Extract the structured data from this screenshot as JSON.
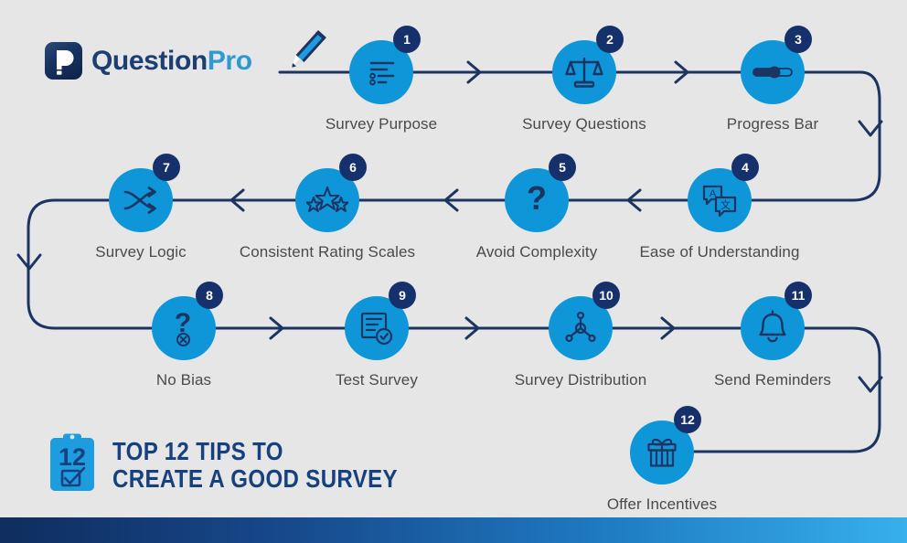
{
  "brand": {
    "logo_icon": "questionpro-p-question-logo",
    "name_part1": "Question",
    "name_part2": "Pro",
    "navy": "#17407e",
    "blue": "#0f96d8"
  },
  "decor": {
    "pencil_icon": "pencil-icon"
  },
  "flow": {
    "nodes": [
      {
        "number": "1",
        "label": "Survey Purpose",
        "icon": "list-document-icon"
      },
      {
        "number": "2",
        "label": "Survey Questions",
        "icon": "balance-scale-icon"
      },
      {
        "number": "3",
        "label": "Progress Bar",
        "icon": "progress-slider-icon"
      },
      {
        "number": "4",
        "label": "Ease of Understanding",
        "icon": "translate-speech-bubbles-icon"
      },
      {
        "number": "5",
        "label": "Avoid Complexity",
        "icon": "question-mark-icon"
      },
      {
        "number": "6",
        "label": "Consistent Rating Scales",
        "icon": "three-stars-icon"
      },
      {
        "number": "7",
        "label": "Survey Logic",
        "icon": "shuffle-arrows-icon"
      },
      {
        "number": "8",
        "label": "No Bias",
        "icon": "question-mark-blocked-icon"
      },
      {
        "number": "9",
        "label": "Test Survey",
        "icon": "document-check-icon"
      },
      {
        "number": "10",
        "label": "Survey Distribution",
        "icon": "share-network-icon"
      },
      {
        "number": "11",
        "label": "Send Reminders",
        "icon": "bell-icon"
      },
      {
        "number": "12",
        "label": "Offer Incentives",
        "icon": "gift-box-icon"
      }
    ]
  },
  "footer": {
    "badge_icon": "clipboard-checkbox-icon",
    "badge_number": "12",
    "title_line1": "Top 12 Tips to",
    "title_line2": "Create a Good Survey"
  }
}
